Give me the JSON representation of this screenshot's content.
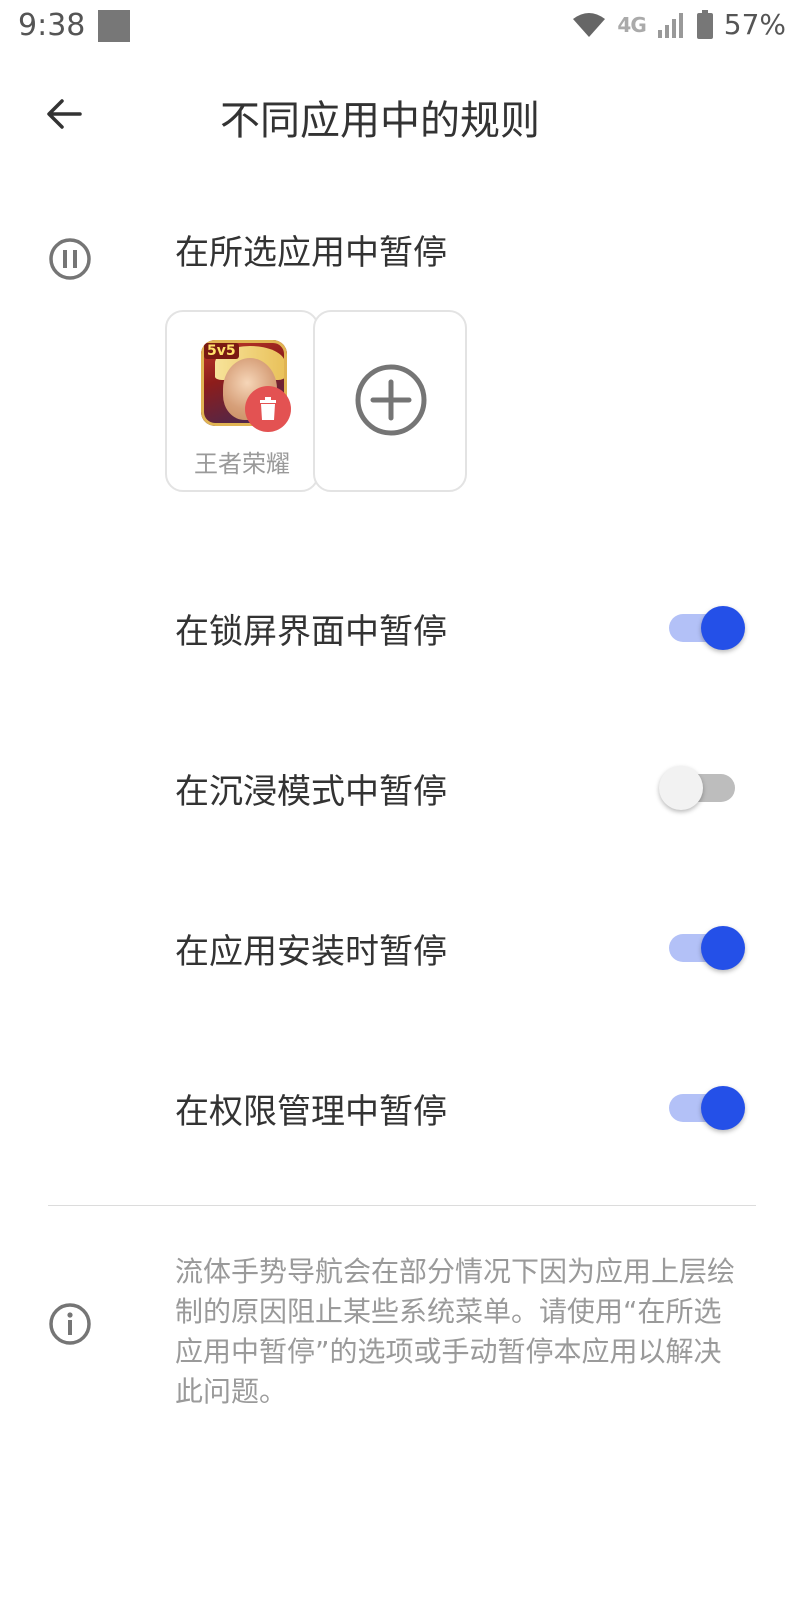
{
  "status_bar": {
    "time": "9:38",
    "network": "4G",
    "battery": "57%",
    "icons": [
      "notification-square-icon",
      "wifi-icon",
      "signal-icon",
      "battery-icon"
    ]
  },
  "header": {
    "title": "不同应用中的规则",
    "back_icon": "arrow-left-icon"
  },
  "selected_apps": {
    "title": "在所选应用中暂停",
    "icon": "pause-circle-icon",
    "apps": [
      {
        "name": "王者荣耀",
        "badge": "5v5",
        "delete_icon": "trash-icon"
      }
    ],
    "add_icon": "add-circle-icon"
  },
  "toggles": [
    {
      "label": "在锁屏界面中暂停",
      "on": true
    },
    {
      "label": "在沉浸模式中暂停",
      "on": false
    },
    {
      "label": "在应用安装时暂停",
      "on": true
    },
    {
      "label": "在权限管理中暂停",
      "on": true
    }
  ],
  "info": {
    "icon": "info-icon",
    "text": "流体手势导航会在部分情况下因为应用上层绘制的原因阻止某些系统菜单。请使用“在所选应用中暂停”的选项或手动暂停本应用以解决此问题。"
  },
  "colors": {
    "accent": "#2450E8",
    "accent_track": "#B3C1F7",
    "delete": "#E35252",
    "secondary_text": "#9A9A9A"
  }
}
